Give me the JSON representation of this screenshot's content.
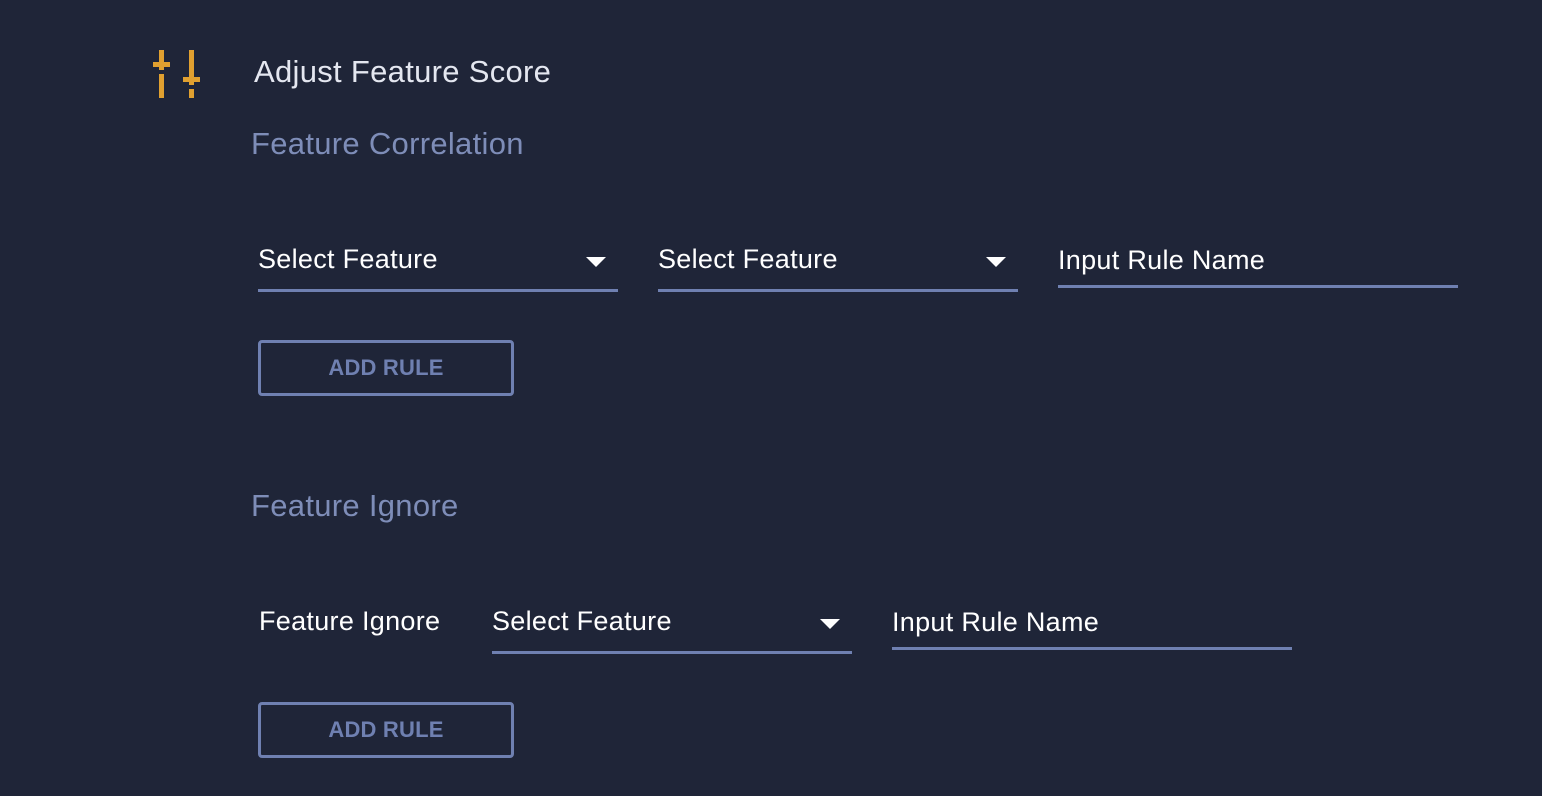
{
  "header": {
    "title": "Adjust Feature Score",
    "icon": "sliders-icon",
    "accent_color": "#e0a030"
  },
  "correlation": {
    "section_title": "Feature Correlation",
    "feature_select_1": "Select Feature",
    "feature_select_2": "Select Feature",
    "rule_name_placeholder": "Input Rule Name",
    "add_button": "ADD RULE"
  },
  "ignore": {
    "section_title": "Feature Ignore",
    "row_label": "Feature Ignore",
    "feature_select": "Select Feature",
    "rule_name_placeholder": "Input Rule Name",
    "add_button": "ADD RULE"
  }
}
